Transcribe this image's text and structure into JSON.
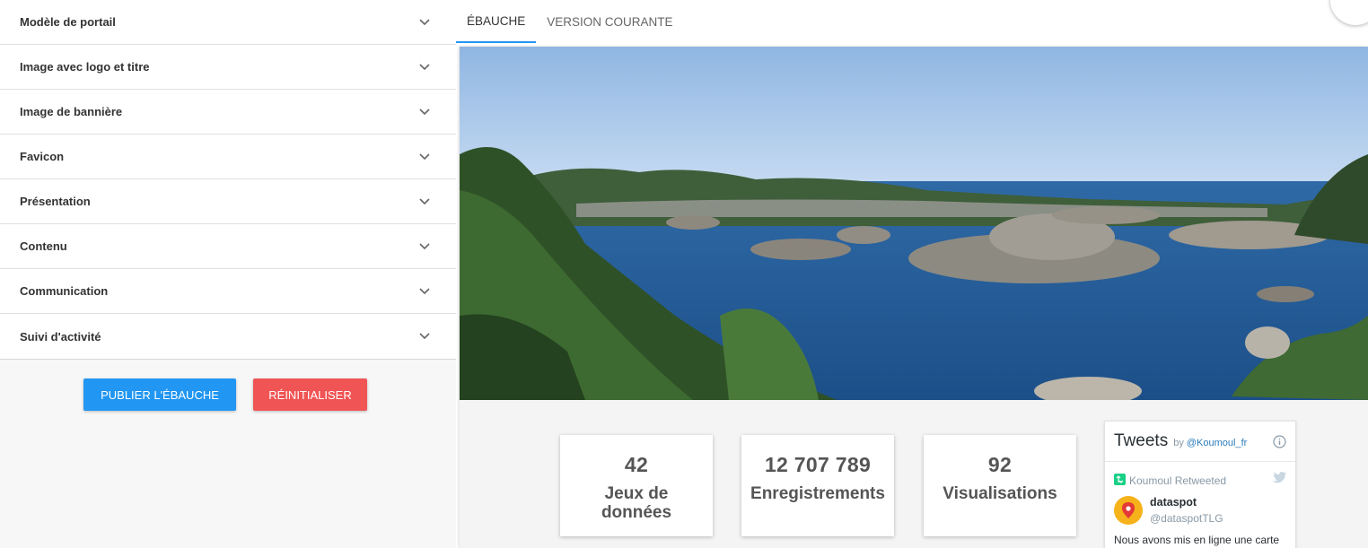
{
  "sidebar": {
    "items": [
      {
        "label": "Modèle de portail"
      },
      {
        "label": "Image avec logo et titre"
      },
      {
        "label": "Image de bannière"
      },
      {
        "label": "Favicon"
      },
      {
        "label": "Présentation"
      },
      {
        "label": "Contenu"
      },
      {
        "label": "Communication"
      },
      {
        "label": "Suivi d'activité"
      }
    ],
    "publish_label": "PUBLIER L'ÉBAUCHE",
    "reset_label": "RÉINITIALISER"
  },
  "tabs": [
    {
      "label": "ÉBAUCHE",
      "active": true
    },
    {
      "label": "VERSION COURANTE",
      "active": false
    }
  ],
  "stats": [
    {
      "value": "42",
      "label": "Jeux de données"
    },
    {
      "value": "12 707 789",
      "label": "Enregistrements"
    },
    {
      "value": "92",
      "label": "Visualisations"
    }
  ],
  "tweets": {
    "title": "Tweets",
    "by": "by",
    "handle": "@Koumoul_fr",
    "retweeted": "Koumoul Retweeted",
    "user_name": "dataspot",
    "user_handle": "@dataspotTLG",
    "text": "Nous avons mis en ligne une carte"
  },
  "colors": {
    "accent": "#2196f3",
    "danger": "#f05454",
    "twitter_link": "#2b7bb9"
  }
}
